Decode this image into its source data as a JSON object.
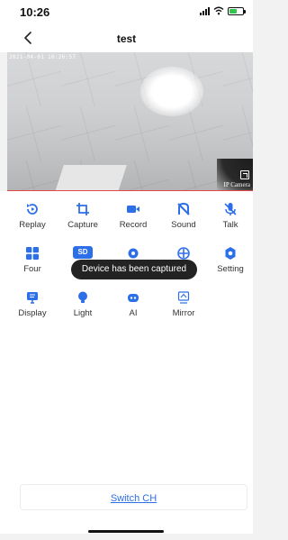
{
  "status_bar": {
    "time": "10:26"
  },
  "nav": {
    "title": "test",
    "back_icon": "chevron-left-icon"
  },
  "video": {
    "timestamp": "2021-04-01 10:26:57",
    "watermark": "IP Camera"
  },
  "controls": {
    "accent_color": "#2d6fe8",
    "rows": [
      [
        {
          "id": "replay",
          "label": "Replay",
          "icon": "replay-icon"
        },
        {
          "id": "capture",
          "label": "Capture",
          "icon": "crop-icon"
        },
        {
          "id": "record",
          "label": "Record",
          "icon": "video-camera-icon"
        },
        {
          "id": "sound",
          "label": "Sound",
          "icon": "sound-icon"
        },
        {
          "id": "talk",
          "label": "Talk",
          "icon": "mic-off-icon"
        }
      ],
      [
        {
          "id": "four",
          "label": "Four",
          "icon": "grid-icon"
        },
        {
          "id": "sd",
          "label": "SD",
          "icon": "sd-badge-icon"
        },
        {
          "id": "gear2",
          "label": "",
          "icon": "gear-icon"
        },
        {
          "id": "crosshair",
          "label": "",
          "icon": "crosshair-icon"
        },
        {
          "id": "setting",
          "label": "Setting",
          "icon": "settings-icon"
        }
      ],
      [
        {
          "id": "display",
          "label": "Display",
          "icon": "display-icon"
        },
        {
          "id": "light",
          "label": "Light",
          "icon": "bulb-icon"
        },
        {
          "id": "ai",
          "label": "AI",
          "icon": "robot-icon"
        },
        {
          "id": "mirror",
          "label": "Mirror",
          "icon": "mirror-icon"
        }
      ]
    ]
  },
  "toast": {
    "message": "Device has been captured"
  },
  "footer": {
    "switch_label": "Switch CH"
  }
}
